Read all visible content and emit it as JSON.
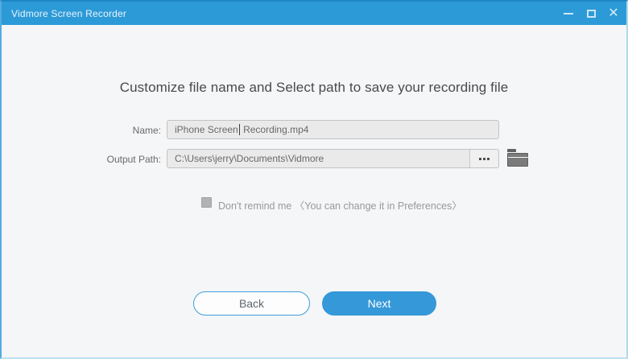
{
  "colors": {
    "titlebar": "#2d9ad8",
    "accent": "#3598d8",
    "content_bg": "#f5f6f7",
    "input_bg": "#eaeaea",
    "checkbox_gray": "#b3b3b3"
  },
  "titlebar": {
    "title": "Vidmore Screen Recorder",
    "icons": {
      "minimize": "minimize-icon",
      "maximize": "maximize-icon",
      "close": "close-icon"
    },
    "close_glyph": "✕"
  },
  "main": {
    "heading": "Customize file name and Select path to save your recording file",
    "name_field": {
      "label": "Name:",
      "value": "iPhone Screen Recording.mp4",
      "value_before_caret": "iPhone Screen",
      "value_after_caret": " Recording.mp4"
    },
    "output_field": {
      "label": "Output Path:",
      "value": "C:\\Users\\jerry\\Documents\\Vidmore",
      "browse_icon": "ellipsis-dots",
      "folder_icon": "open-folder"
    },
    "checkbox": {
      "checked": false,
      "label": "Don't remind me 〈You can change it in Preferences〉"
    },
    "buttons": {
      "back": "Back",
      "next": "Next"
    }
  }
}
